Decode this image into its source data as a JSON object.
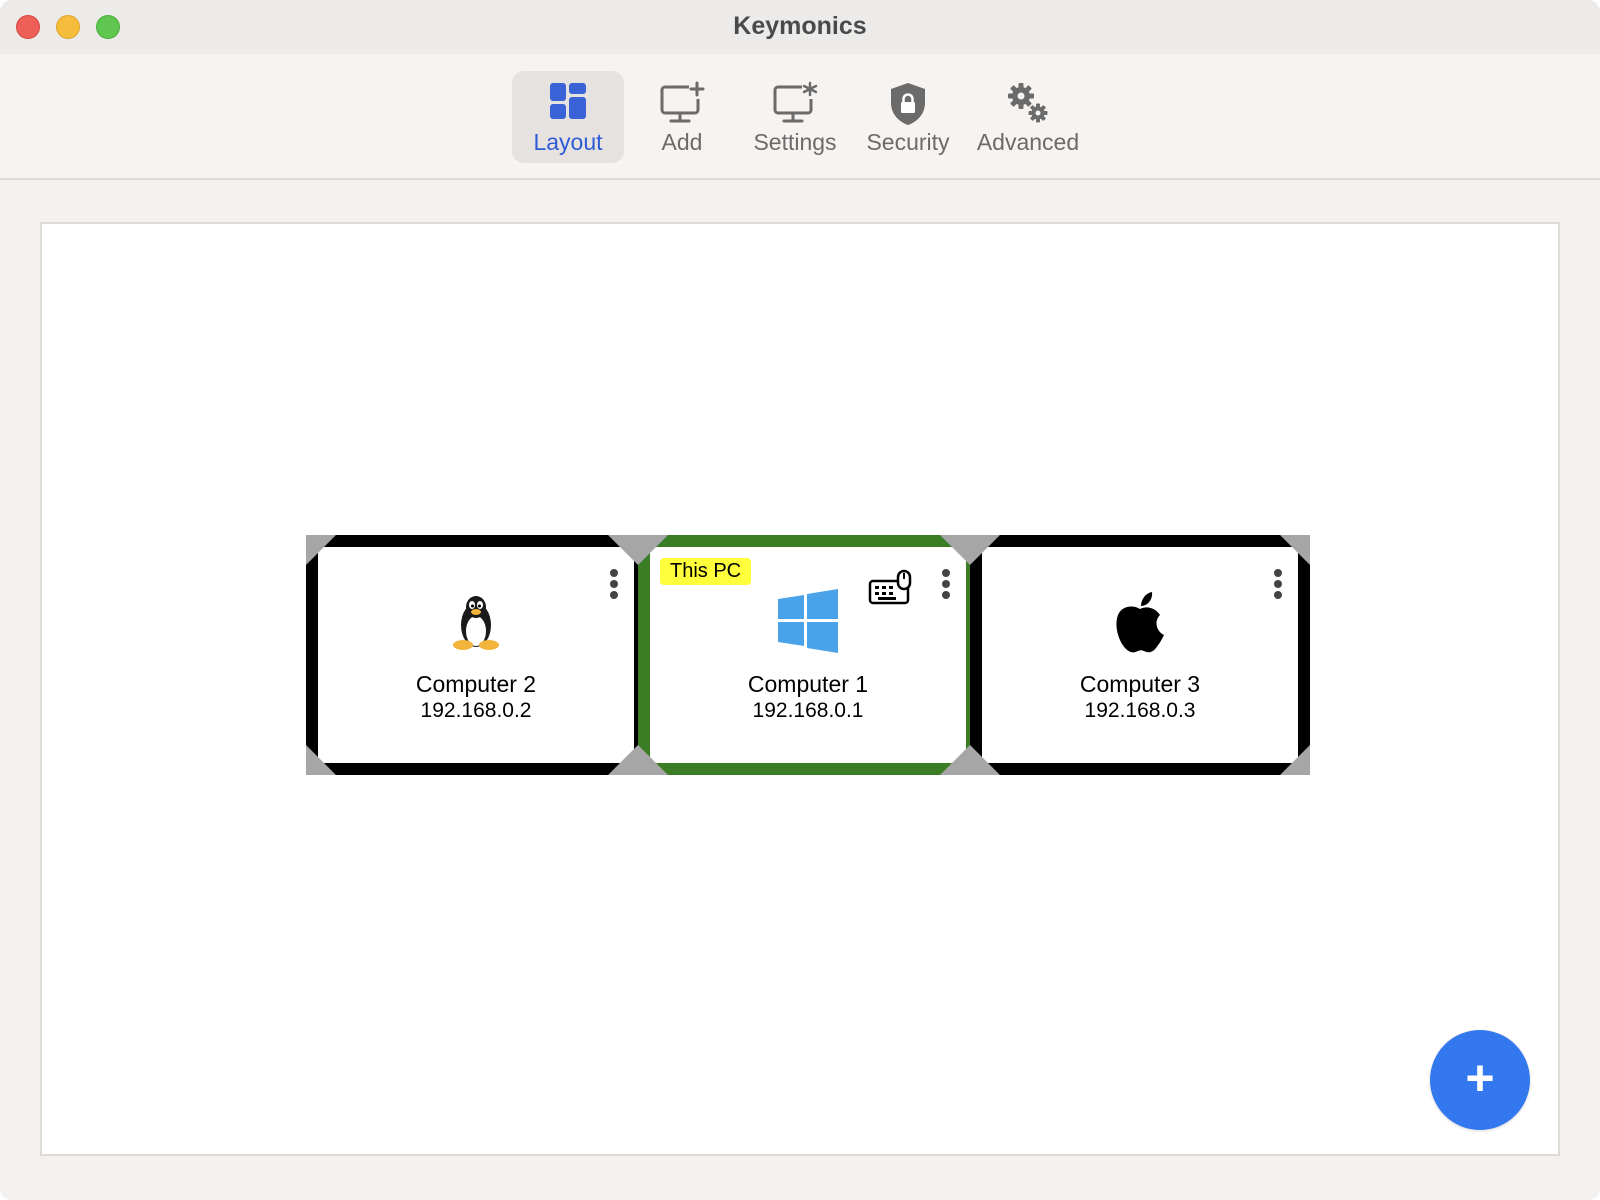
{
  "window": {
    "title": "Keymonics"
  },
  "toolbar": {
    "tabs": [
      {
        "label": "Layout",
        "icon": "layout-icon",
        "active": true
      },
      {
        "label": "Add",
        "icon": "add-monitor-icon",
        "active": false
      },
      {
        "label": "Settings",
        "icon": "monitor-settings-icon",
        "active": false
      },
      {
        "label": "Security",
        "icon": "shield-lock-icon",
        "active": false
      },
      {
        "label": "Advanced",
        "icon": "gears-icon",
        "active": false
      }
    ]
  },
  "layout": {
    "computers": [
      {
        "name": "Computer 2",
        "ip": "192.168.0.2",
        "os_icon": "linux-tux-icon",
        "this_pc": false
      },
      {
        "name": "Computer 1",
        "ip": "192.168.0.1",
        "os_icon": "windows-icon",
        "this_pc": true,
        "badge": "This PC",
        "input_icon": "keyboard-mouse-icon"
      },
      {
        "name": "Computer 3",
        "ip": "192.168.0.3",
        "os_icon": "apple-icon",
        "this_pc": false
      }
    ]
  },
  "fab": {
    "label": "+",
    "icon": "plus-icon"
  },
  "colors": {
    "accent": "#3478f0",
    "active_tab_text": "#2e5bd6",
    "current_computer_border": "#3a7d24",
    "computer_border": "#000000",
    "badge_bg": "#ffff3c"
  }
}
